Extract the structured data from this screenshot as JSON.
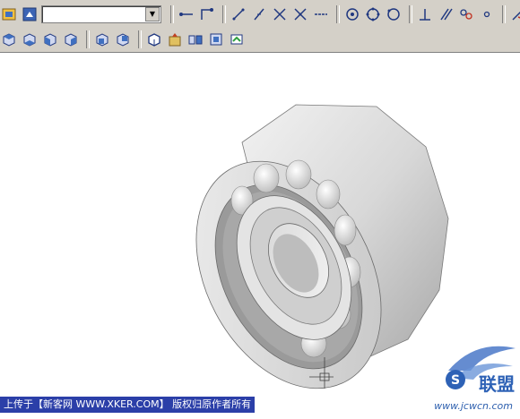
{
  "toolbar": {
    "layer_combo_value": "",
    "row1_icons": [
      "layer-manager-icon",
      "layer-previous-icon",
      "quick-dimension-icon",
      "linear-dimension-icon",
      "aligned-dimension-icon",
      "arc-length-icon",
      "ordinate-dimension-icon",
      "radius-dimension-icon",
      "diameter-dimension-icon",
      "angular-dimension-icon",
      "baseline-dimension-icon",
      "continue-dimension-icon",
      "center-mark-icon",
      "tolerance-icon",
      "leader-icon",
      "dimension-edit-icon"
    ],
    "row2_icons": [
      "top-view-icon",
      "bottom-view-icon",
      "left-view-icon",
      "right-view-icon",
      "front-view-icon",
      "back-view-icon",
      "sw-iso-view-icon",
      "se-iso-view-icon",
      "ne-iso-view-icon",
      "nw-iso-view-icon",
      "camera-icon"
    ]
  },
  "canvas": {
    "object_name": "ball-bearing-3d-model",
    "background_color": "#ffffff"
  },
  "watermark": {
    "text": "上传于【新客网 WWW.XKER.COM】 版权归原作者所有"
  },
  "site_logo": {
    "brand": "联盟",
    "url": "www.jcwcn.com"
  }
}
